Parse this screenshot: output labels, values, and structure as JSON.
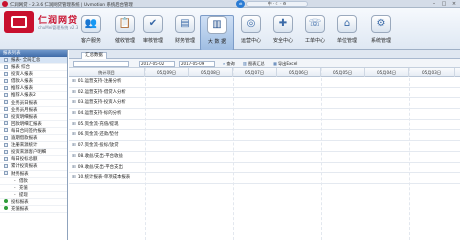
{
  "window": {
    "title": "仁润网贷 - 2.3.6 仁润网贷管理系统 | Uvmotion 系统后台管理"
  },
  "cloud_badge": "dt",
  "sys_widget": "中 · ☾ · ⚙",
  "brand": {
    "name": "仁润网贷",
    "sub": "chuMei管理系统 v2.3"
  },
  "nav": [
    {
      "label": "客户服务",
      "icon": "customer-icon",
      "glyph": "👥"
    },
    {
      "label": "催收管理",
      "icon": "collection-icon",
      "glyph": "📋"
    },
    {
      "label": "审核管理",
      "icon": "audit-icon",
      "glyph": "✔"
    },
    {
      "label": "财务管理",
      "icon": "finance-icon",
      "glyph": "▤"
    },
    {
      "label": "大 数 据",
      "icon": "bigdata-icon",
      "glyph": "▥",
      "active": true
    },
    {
      "label": "运营中心",
      "icon": "operation-icon",
      "glyph": "◎"
    },
    {
      "label": "安全中心",
      "icon": "security-icon",
      "glyph": "✚"
    },
    {
      "label": "工单中心",
      "icon": "ticket-icon",
      "glyph": "☏"
    },
    {
      "label": "单位管理",
      "icon": "unit-icon",
      "glyph": "⌂"
    },
    {
      "label": "系统管理",
      "icon": "system-icon",
      "glyph": "⚙"
    }
  ],
  "sidebar": {
    "title": "报表列表",
    "items": [
      "报表- 全局汇总",
      "报表 综合",
      "投资人报表",
      "借款人报表",
      "推荐人报表",
      "推荐人报表2",
      "业务员日报表",
      "业务员月报表",
      "投资明细报表",
      "回款明细汇报表",
      "每日合同签约报表",
      "逾期借款报表",
      "注册来源统计",
      "投资来源客户明细",
      "每日投标总额",
      "累计投资报表",
      "财务报表",
      "借款",
      "充值",
      "提现",
      "投标报表",
      "充值报表"
    ]
  },
  "tab": {
    "label": "汇总数据"
  },
  "toolbar": {
    "date_start": "2017-05-02",
    "date_end": "2017-05-09",
    "query_label": "查询",
    "chart_label": "图表汇总",
    "export_label": "导出Excel"
  },
  "grid": {
    "columns": [
      "统计项目",
      "05月09日",
      "05月08日",
      "05月07日",
      "05月06日",
      "05月05日",
      "05月04日",
      "05月03日"
    ],
    "rows": [
      "01.运营支持-注册分析",
      "02.运营支持-借贷人分析",
      "03.运营支持-投资人分析",
      "04.运营支持-标的分析",
      "05.资金流-充值/提现",
      "06.资金流-还款/垫付",
      "07.资金流-投标/放贷",
      "08.收益/支出-平台收益",
      "09.收益/支出-平台支出",
      "10.统计报表-单项成本报表"
    ]
  }
}
